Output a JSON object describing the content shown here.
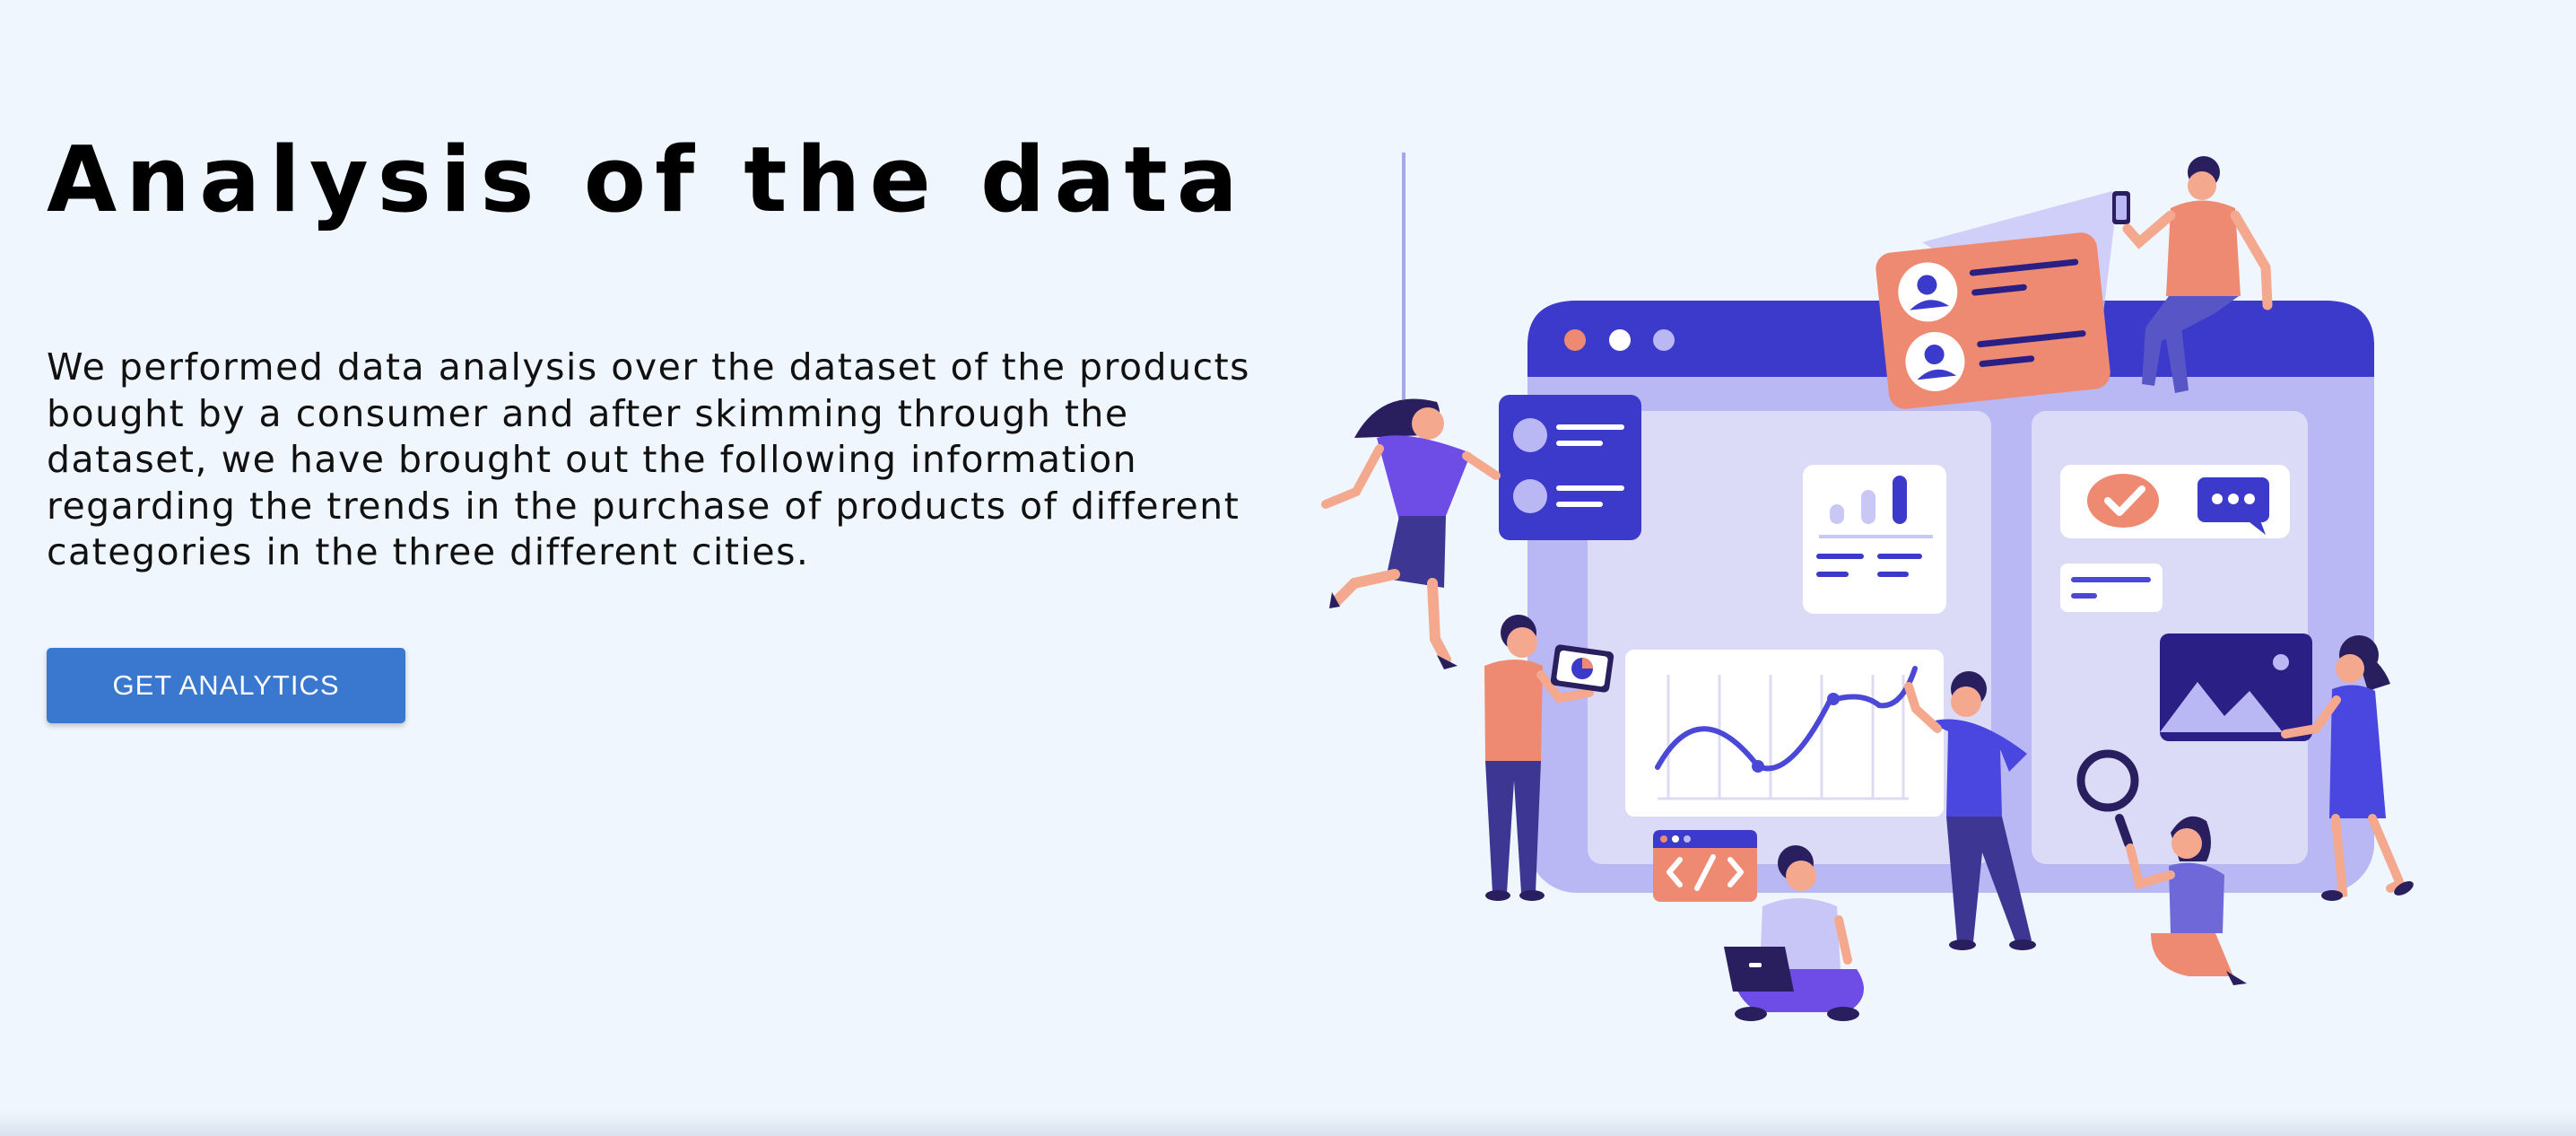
{
  "hero": {
    "title": "Analysis of the data",
    "description": "We performed data analysis over the dataset of the products bought by a consumer and after skimming through the dataset, we have brought out the following information regarding the trends in the purchase of products of different categories in the three different cities.",
    "button_label": "GET ANALYTICS"
  },
  "colors": {
    "background": "#eff6fd",
    "button": "#3a78d0",
    "accent_indigo": "#3c3acb",
    "accent_coral": "#ee8a72",
    "panel_lavender": "#b8b6f3"
  },
  "illustration": {
    "icons": [
      "browser-window-icon",
      "profile-card-icon",
      "bar-chart-icon",
      "line-chart-icon",
      "checkmark-icon",
      "chat-bubble-icon",
      "code-icon",
      "image-icon",
      "magnifier-icon",
      "pie-chart-icon"
    ]
  }
}
